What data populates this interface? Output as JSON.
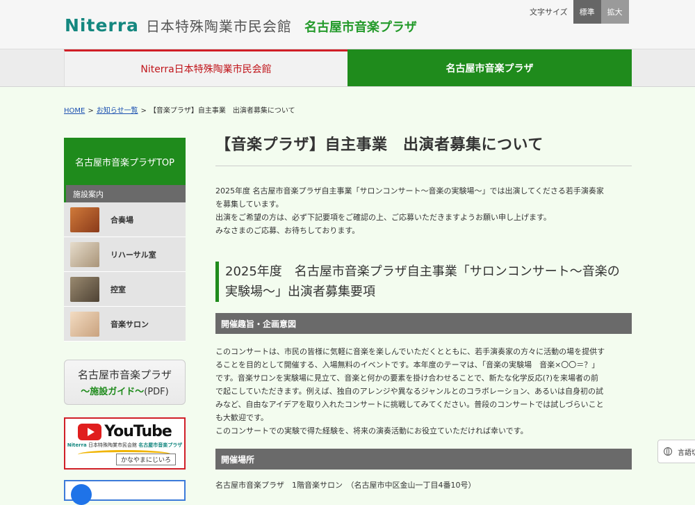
{
  "header": {
    "logo_brand": "Niterra",
    "logo_hall": "日本特殊陶業市民会館",
    "logo_plaza": "名古屋市音楽プラザ",
    "font_size_label": "文字サイズ",
    "font_standard": "標準",
    "font_large": "拡大"
  },
  "tabs": {
    "hall": "Niterra日本特殊陶業市民会館",
    "plaza": "名古屋市音楽プラザ"
  },
  "breadcrumb": {
    "home": "HOME",
    "news": "お知らせ一覧",
    "current": "【音楽プラザ】自主事業　出演者募集について",
    "separator": ">"
  },
  "sidebar": {
    "top_link": "名古屋市音楽プラザTOP",
    "section": "施設案内",
    "items": [
      {
        "label": "合奏場",
        "thumb": "#b45a2e"
      },
      {
        "label": "リハーサル室",
        "thumb": "#c8b598"
      },
      {
        "label": "控室",
        "thumb": "#7a6a55"
      },
      {
        "label": "音楽サロン",
        "thumb": "#e8c9a8"
      }
    ],
    "guide_line1": "名古屋市音楽プラザ",
    "guide_line2": "～施設ガイド～",
    "guide_pdf": "(PDF)",
    "yt_word": "YouTube",
    "yt_sub_brand": "Niterra",
    "yt_sub_hall": "日本特殊陶業市民会館",
    "yt_sub_plaza": "名古屋市音楽プラザ",
    "yt_kana": "かなやまにじいろ"
  },
  "main": {
    "title": "【音楽プラザ】自主事業　出演者募集について",
    "intro": [
      "2025年度 名古屋市音楽プラザ自主事業「サロンコンサート～音楽の実験場～」では出演してくださる若手演奏家",
      "を募集しています。",
      "出演をご希望の方は、必ず下記要項をご確認の上、ご応募いただきますようお願い申し上げます。",
      "みなさまのご応募、お待ちしております。"
    ],
    "heading": "2025年度　名古屋市音楽プラザ自主事業「サロンコンサート～音楽の実験場～」出演者募集要項",
    "section1": "開催趣旨・企画意図",
    "body1": [
      "このコンサートは、市民の皆様に気軽に音楽を楽しんでいただくとともに、若手演奏家の方々に活動の場を提供す",
      "ることを目的として開催する、入場無料のイベントです。本年度のテーマは、「音楽の実験場　音楽×〇〇＝？」",
      "です。音楽サロンを実験場に見立て、音楽と何かの要素を掛け合わせることで、新たな化学反応(?)を来場者の前",
      "で起こしていただきます。例えば、独自のアレンジや異なるジャンルとのコラボレーション、あるいは自身初の試",
      "みなど、自由なアイデアを取り入れたコンサートに挑戦してみてください。普段のコンサートでは試しづらいこと",
      "も大歓迎です。",
      "このコンサートでの実験で得た経験を、将来の演奏活動にお役立ていただければ幸いです。"
    ],
    "section2": "開催場所",
    "venue": "名古屋市音楽プラザ　1階音楽サロン　（名古屋市中区金山一丁目4番10号）"
  },
  "language_button": "言語切"
}
